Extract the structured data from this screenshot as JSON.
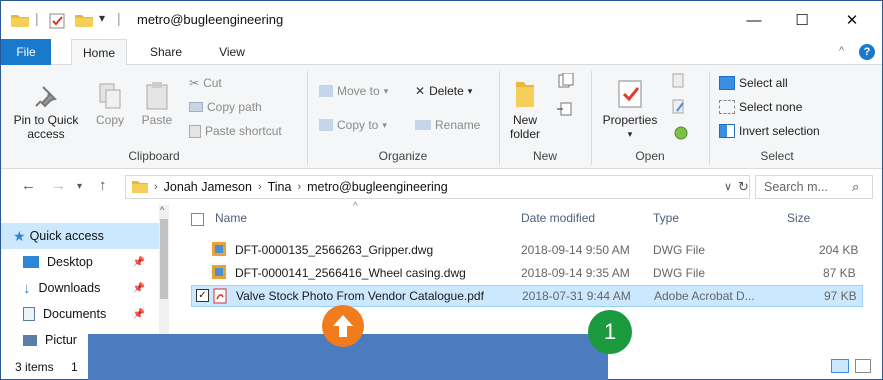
{
  "window": {
    "title": "metro@bugleengineering",
    "controls": {
      "minimize": "—",
      "maximize": "☐",
      "close": "✕"
    }
  },
  "tabs": [
    {
      "label": "File"
    },
    {
      "label": "Home"
    },
    {
      "label": "Share"
    },
    {
      "label": "View"
    }
  ],
  "ribbon": {
    "clipboard": {
      "label": "Clipboard",
      "pin_line1": "Pin to Quick",
      "pin_line2": "access",
      "copy": "Copy",
      "paste": "Paste",
      "cut": "Cut",
      "copy_path": "Copy path",
      "paste_shortcut": "Paste shortcut"
    },
    "organize": {
      "label": "Organize",
      "move_to": "Move to",
      "copy_to": "Copy to",
      "delete": "Delete",
      "rename": "Rename"
    },
    "new": {
      "label": "New",
      "new_line1": "New",
      "new_line2": "folder"
    },
    "open": {
      "label": "Open",
      "properties": "Properties"
    },
    "select": {
      "label": "Select",
      "select_all": "Select all",
      "select_none": "Select none",
      "invert_selection": "Invert selection"
    },
    "colors": {
      "accent": "#1979ca",
      "ribbon_bg": "#f5f6f7"
    }
  },
  "address": {
    "crumbs": [
      "Jonah Jameson",
      "Tina",
      "metro@bugleengineering"
    ],
    "search_placeholder": "Search m..."
  },
  "navpane": {
    "items": [
      {
        "label": "Quick access",
        "icon": "star-icon"
      },
      {
        "label": "Desktop",
        "icon": "desktop-icon"
      },
      {
        "label": "Downloads",
        "icon": "download-icon"
      },
      {
        "label": "Documents",
        "icon": "documents-icon"
      },
      {
        "label": "Pictur",
        "icon": "pictures-icon"
      }
    ]
  },
  "filelist": {
    "columns": {
      "name": "Name",
      "date": "Date modified",
      "type": "Type",
      "size": "Size"
    },
    "rows": [
      {
        "name": "DFT-0000135_2566263_Gripper.dwg",
        "date": "2018-09-14 9:50 AM",
        "type": "DWG File",
        "size": "204 KB",
        "selected": false
      },
      {
        "name": "DFT-0000141_2566416_Wheel casing.dwg",
        "date": "2018-09-14 9:35 AM",
        "type": "DWG File",
        "size": "87 KB",
        "selected": false
      },
      {
        "name": "Valve Stock Photo From Vendor Catalogue.pdf",
        "date": "2018-07-31 9:44 AM",
        "type": "Adobe Acrobat D...",
        "size": "97 KB",
        "selected": true
      }
    ]
  },
  "statusbar": {
    "items_count": "3 items",
    "partial": "1"
  },
  "overlay": {
    "badge_number": "1"
  }
}
